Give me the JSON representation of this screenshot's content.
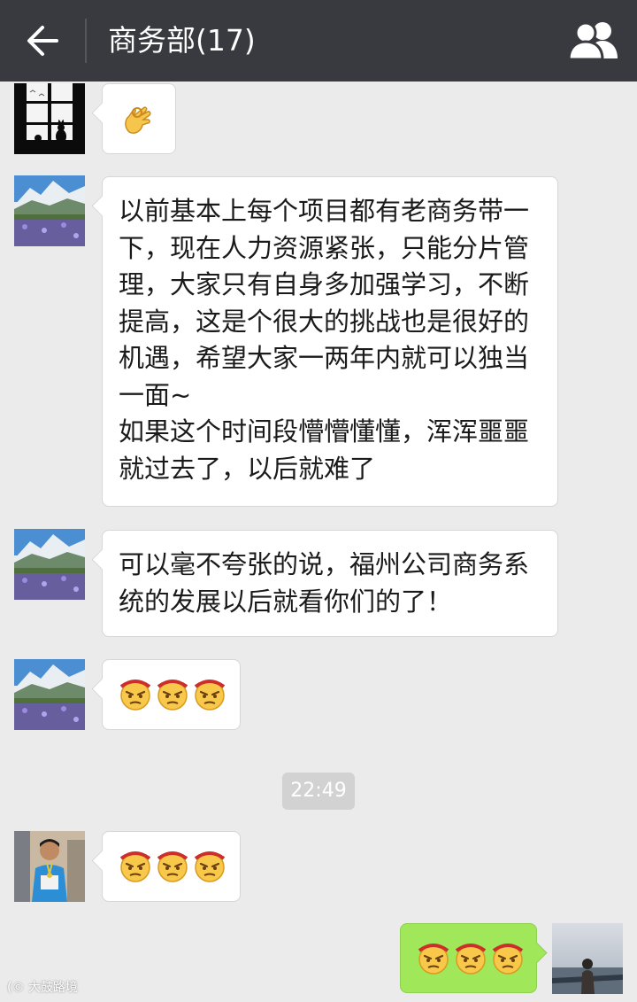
{
  "header": {
    "title": "商务部(17)",
    "back_icon": "back-arrow-icon",
    "group_icon": "group-members-icon",
    "background": "#393a3f"
  },
  "messages": [
    {
      "sender": "window-cat",
      "type": "emoji",
      "emoji": [
        "ok-hand"
      ]
    },
    {
      "sender": "mountain-flowers",
      "type": "text",
      "text": "以前基本上每个项目都有老商务带一下，现在人力资源紧张，只能分片管理，大家只有自身多加强学习，不断提高，这是个很大的挑战也是很好的机遇，希望大家一两年内就可以独当一面~\n如果这个时间段懵懵懂懂，浑浑噩噩就过去了，以后就难了"
    },
    {
      "sender": "mountain-flowers",
      "type": "text",
      "text": "可以毫不夸张的说，福州公司商务系统的发展以后就看你们的了！"
    },
    {
      "sender": "mountain-flowers",
      "type": "emoji",
      "emoji": [
        "frown",
        "frown",
        "frown"
      ]
    },
    {
      "sender": "runner",
      "type": "emoji",
      "emoji": [
        "frown",
        "frown",
        "frown"
      ]
    },
    {
      "sender": "self",
      "type": "emoji",
      "emoji": [
        "frown",
        "frown",
        "frown"
      ]
    }
  ],
  "timestamp": "22:49",
  "watermark": "大鼓路境",
  "colors": {
    "chat_bg": "#ebebeb",
    "bubble_in": "#ffffff",
    "bubble_out": "#a0e75a"
  }
}
